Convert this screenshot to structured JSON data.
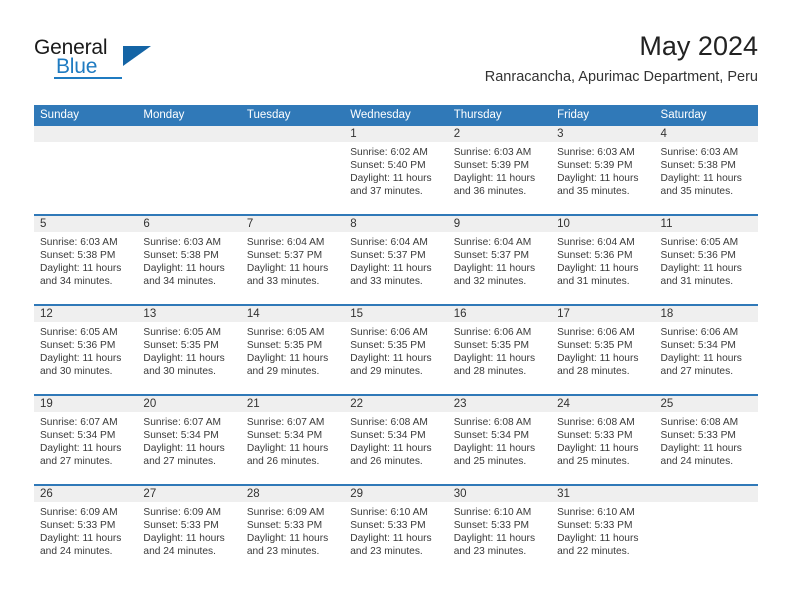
{
  "logo": {
    "word_top": "General",
    "word_bottom": "Blue",
    "accent_color": "#1f7bc1",
    "triangle_color": "#1464a5"
  },
  "header": {
    "title": "May 2024",
    "subtitle": "Ranracancha, Apurimac Department, Peru"
  },
  "theme": {
    "header_blue": "#3079b8",
    "band_gray": "#efefef",
    "text_color": "#333333"
  },
  "weekdays": [
    "Sunday",
    "Monday",
    "Tuesday",
    "Wednesday",
    "Thursday",
    "Friday",
    "Saturday"
  ],
  "weeks": [
    [
      {
        "day": "",
        "empty": true
      },
      {
        "day": "",
        "empty": true
      },
      {
        "day": "",
        "empty": true
      },
      {
        "day": "1",
        "sunrise": "Sunrise: 6:02 AM",
        "sunset": "Sunset: 5:40 PM",
        "daylight1": "Daylight: 11 hours",
        "daylight2": "and 37 minutes."
      },
      {
        "day": "2",
        "sunrise": "Sunrise: 6:03 AM",
        "sunset": "Sunset: 5:39 PM",
        "daylight1": "Daylight: 11 hours",
        "daylight2": "and 36 minutes."
      },
      {
        "day": "3",
        "sunrise": "Sunrise: 6:03 AM",
        "sunset": "Sunset: 5:39 PM",
        "daylight1": "Daylight: 11 hours",
        "daylight2": "and 35 minutes."
      },
      {
        "day": "4",
        "sunrise": "Sunrise: 6:03 AM",
        "sunset": "Sunset: 5:38 PM",
        "daylight1": "Daylight: 11 hours",
        "daylight2": "and 35 minutes."
      }
    ],
    [
      {
        "day": "5",
        "sunrise": "Sunrise: 6:03 AM",
        "sunset": "Sunset: 5:38 PM",
        "daylight1": "Daylight: 11 hours",
        "daylight2": "and 34 minutes."
      },
      {
        "day": "6",
        "sunrise": "Sunrise: 6:03 AM",
        "sunset": "Sunset: 5:38 PM",
        "daylight1": "Daylight: 11 hours",
        "daylight2": "and 34 minutes."
      },
      {
        "day": "7",
        "sunrise": "Sunrise: 6:04 AM",
        "sunset": "Sunset: 5:37 PM",
        "daylight1": "Daylight: 11 hours",
        "daylight2": "and 33 minutes."
      },
      {
        "day": "8",
        "sunrise": "Sunrise: 6:04 AM",
        "sunset": "Sunset: 5:37 PM",
        "daylight1": "Daylight: 11 hours",
        "daylight2": "and 33 minutes."
      },
      {
        "day": "9",
        "sunrise": "Sunrise: 6:04 AM",
        "sunset": "Sunset: 5:37 PM",
        "daylight1": "Daylight: 11 hours",
        "daylight2": "and 32 minutes."
      },
      {
        "day": "10",
        "sunrise": "Sunrise: 6:04 AM",
        "sunset": "Sunset: 5:36 PM",
        "daylight1": "Daylight: 11 hours",
        "daylight2": "and 31 minutes."
      },
      {
        "day": "11",
        "sunrise": "Sunrise: 6:05 AM",
        "sunset": "Sunset: 5:36 PM",
        "daylight1": "Daylight: 11 hours",
        "daylight2": "and 31 minutes."
      }
    ],
    [
      {
        "day": "12",
        "sunrise": "Sunrise: 6:05 AM",
        "sunset": "Sunset: 5:36 PM",
        "daylight1": "Daylight: 11 hours",
        "daylight2": "and 30 minutes."
      },
      {
        "day": "13",
        "sunrise": "Sunrise: 6:05 AM",
        "sunset": "Sunset: 5:35 PM",
        "daylight1": "Daylight: 11 hours",
        "daylight2": "and 30 minutes."
      },
      {
        "day": "14",
        "sunrise": "Sunrise: 6:05 AM",
        "sunset": "Sunset: 5:35 PM",
        "daylight1": "Daylight: 11 hours",
        "daylight2": "and 29 minutes."
      },
      {
        "day": "15",
        "sunrise": "Sunrise: 6:06 AM",
        "sunset": "Sunset: 5:35 PM",
        "daylight1": "Daylight: 11 hours",
        "daylight2": "and 29 minutes."
      },
      {
        "day": "16",
        "sunrise": "Sunrise: 6:06 AM",
        "sunset": "Sunset: 5:35 PM",
        "daylight1": "Daylight: 11 hours",
        "daylight2": "and 28 minutes."
      },
      {
        "day": "17",
        "sunrise": "Sunrise: 6:06 AM",
        "sunset": "Sunset: 5:35 PM",
        "daylight1": "Daylight: 11 hours",
        "daylight2": "and 28 minutes."
      },
      {
        "day": "18",
        "sunrise": "Sunrise: 6:06 AM",
        "sunset": "Sunset: 5:34 PM",
        "daylight1": "Daylight: 11 hours",
        "daylight2": "and 27 minutes."
      }
    ],
    [
      {
        "day": "19",
        "sunrise": "Sunrise: 6:07 AM",
        "sunset": "Sunset: 5:34 PM",
        "daylight1": "Daylight: 11 hours",
        "daylight2": "and 27 minutes."
      },
      {
        "day": "20",
        "sunrise": "Sunrise: 6:07 AM",
        "sunset": "Sunset: 5:34 PM",
        "daylight1": "Daylight: 11 hours",
        "daylight2": "and 27 minutes."
      },
      {
        "day": "21",
        "sunrise": "Sunrise: 6:07 AM",
        "sunset": "Sunset: 5:34 PM",
        "daylight1": "Daylight: 11 hours",
        "daylight2": "and 26 minutes."
      },
      {
        "day": "22",
        "sunrise": "Sunrise: 6:08 AM",
        "sunset": "Sunset: 5:34 PM",
        "daylight1": "Daylight: 11 hours",
        "daylight2": "and 26 minutes."
      },
      {
        "day": "23",
        "sunrise": "Sunrise: 6:08 AM",
        "sunset": "Sunset: 5:34 PM",
        "daylight1": "Daylight: 11 hours",
        "daylight2": "and 25 minutes."
      },
      {
        "day": "24",
        "sunrise": "Sunrise: 6:08 AM",
        "sunset": "Sunset: 5:33 PM",
        "daylight1": "Daylight: 11 hours",
        "daylight2": "and 25 minutes."
      },
      {
        "day": "25",
        "sunrise": "Sunrise: 6:08 AM",
        "sunset": "Sunset: 5:33 PM",
        "daylight1": "Daylight: 11 hours",
        "daylight2": "and 24 minutes."
      }
    ],
    [
      {
        "day": "26",
        "sunrise": "Sunrise: 6:09 AM",
        "sunset": "Sunset: 5:33 PM",
        "daylight1": "Daylight: 11 hours",
        "daylight2": "and 24 minutes."
      },
      {
        "day": "27",
        "sunrise": "Sunrise: 6:09 AM",
        "sunset": "Sunset: 5:33 PM",
        "daylight1": "Daylight: 11 hours",
        "daylight2": "and 24 minutes."
      },
      {
        "day": "28",
        "sunrise": "Sunrise: 6:09 AM",
        "sunset": "Sunset: 5:33 PM",
        "daylight1": "Daylight: 11 hours",
        "daylight2": "and 23 minutes."
      },
      {
        "day": "29",
        "sunrise": "Sunrise: 6:10 AM",
        "sunset": "Sunset: 5:33 PM",
        "daylight1": "Daylight: 11 hours",
        "daylight2": "and 23 minutes."
      },
      {
        "day": "30",
        "sunrise": "Sunrise: 6:10 AM",
        "sunset": "Sunset: 5:33 PM",
        "daylight1": "Daylight: 11 hours",
        "daylight2": "and 23 minutes."
      },
      {
        "day": "31",
        "sunrise": "Sunrise: 6:10 AM",
        "sunset": "Sunset: 5:33 PM",
        "daylight1": "Daylight: 11 hours",
        "daylight2": "and 22 minutes."
      },
      {
        "day": "",
        "empty": true
      }
    ]
  ]
}
